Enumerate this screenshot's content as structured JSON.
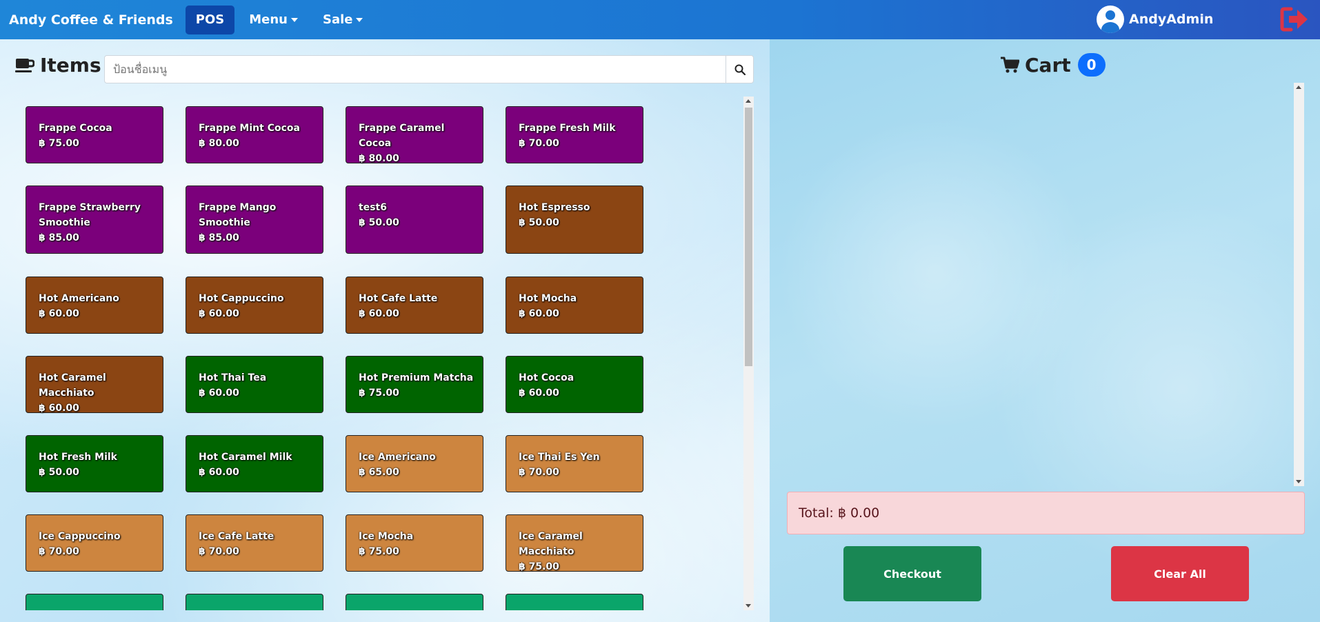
{
  "navbar": {
    "brand": "Andy Coffee & Friends",
    "links": [
      {
        "label": "POS",
        "active": true,
        "dropdown": false
      },
      {
        "label": "Menu",
        "active": false,
        "dropdown": true
      },
      {
        "label": "Sale",
        "active": false,
        "dropdown": true
      }
    ],
    "user_name": "AndyAdmin",
    "logout_icon": "logout-icon"
  },
  "items_panel": {
    "title": "Items",
    "search_placeholder": "ป้อนชื่อเมนู"
  },
  "colors": {
    "frappe": "#7b007b",
    "hot_coffee": "#8b4513",
    "hot_green": "#006400",
    "ice": "#cd853f",
    "teal": "#0aa56a"
  },
  "menu_items": [
    {
      "name": "Frappe Cocoa",
      "price": "฿ 75.00",
      "color": "#7b007b"
    },
    {
      "name": "Frappe Mint Cocoa",
      "price": "฿ 80.00",
      "color": "#7b007b"
    },
    {
      "name": "Frappe Caramel Cocoa",
      "price": "฿ 80.00",
      "color": "#7b007b"
    },
    {
      "name": "Frappe Fresh Milk",
      "price": "฿ 70.00",
      "color": "#7b007b"
    },
    {
      "name": "Frappe Strawberry Smoothie",
      "price": "฿ 85.00",
      "color": "#7b007b"
    },
    {
      "name": "Frappe Mango Smoothie",
      "price": "฿ 85.00",
      "color": "#7b007b"
    },
    {
      "name": "test6",
      "price": "฿ 50.00",
      "color": "#7b007b"
    },
    {
      "name": "Hot Espresso",
      "price": "฿ 50.00",
      "color": "#8b4513"
    },
    {
      "name": "Hot Americano",
      "price": "฿ 60.00",
      "color": "#8b4513"
    },
    {
      "name": "Hot Cappuccino",
      "price": "฿ 60.00",
      "color": "#8b4513"
    },
    {
      "name": "Hot Cafe Latte",
      "price": "฿ 60.00",
      "color": "#8b4513"
    },
    {
      "name": "Hot Mocha",
      "price": "฿ 60.00",
      "color": "#8b4513"
    },
    {
      "name": "Hot Caramel Macchiato",
      "price": "฿ 60.00",
      "color": "#8b4513"
    },
    {
      "name": "Hot Thai Tea",
      "price": "฿ 60.00",
      "color": "#006400"
    },
    {
      "name": "Hot Premium Matcha",
      "price": "฿ 75.00",
      "color": "#006400"
    },
    {
      "name": "Hot Cocoa",
      "price": "฿ 60.00",
      "color": "#006400"
    },
    {
      "name": "Hot Fresh Milk",
      "price": "฿ 50.00",
      "color": "#006400"
    },
    {
      "name": "Hot Caramel Milk",
      "price": "฿ 60.00",
      "color": "#006400"
    },
    {
      "name": "Ice Americano",
      "price": "฿ 65.00",
      "color": "#cd853f"
    },
    {
      "name": "Ice Thai Es Yen",
      "price": "฿ 70.00",
      "color": "#cd853f"
    },
    {
      "name": "Ice Cappuccino",
      "price": "฿ 70.00",
      "color": "#cd853f"
    },
    {
      "name": "Ice Cafe Latte",
      "price": "฿ 70.00",
      "color": "#cd853f"
    },
    {
      "name": "Ice Mocha",
      "price": "฿ 75.00",
      "color": "#cd853f"
    },
    {
      "name": "Ice Caramel Macchiato",
      "price": "฿ 75.00",
      "color": "#cd853f"
    }
  ],
  "cart": {
    "title": "Cart",
    "count": "0",
    "total_label": "Total: ฿ 0.00",
    "checkout_label": "Checkout",
    "clear_label": "Clear All"
  }
}
